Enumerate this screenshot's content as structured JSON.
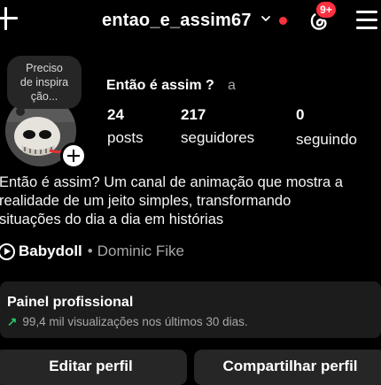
{
  "header": {
    "username": "entao_e_assim67",
    "notification_count": "9+"
  },
  "profile": {
    "note": [
      "Preciso",
      "de inspira",
      "ção..."
    ],
    "display_name": "Então é assim ?",
    "pronoun": "a"
  },
  "stats": [
    {
      "value": "24",
      "label": "posts"
    },
    {
      "value": "217",
      "label": "seguidores"
    },
    {
      "value": "0",
      "label": "seguindo"
    }
  ],
  "bio": [
    "Então é assim? Um canal de animação que mostra a",
    "realidade de um jeito simples, transformando",
    "situações do dia a dia em histórias"
  ],
  "music": {
    "song": "Babydoll",
    "separator": "•",
    "artist": "Dominic Fike"
  },
  "panel": {
    "title": "Painel profissional",
    "subtitle": "99,4 mil visualizações nos últimos 30 dias."
  },
  "buttons": {
    "edit": "Editar perfil",
    "share": "Compartilhar perfil"
  },
  "colors": {
    "accent_red": "#ff3040",
    "trend_green": "#2ec46b",
    "surface": "#262626"
  }
}
